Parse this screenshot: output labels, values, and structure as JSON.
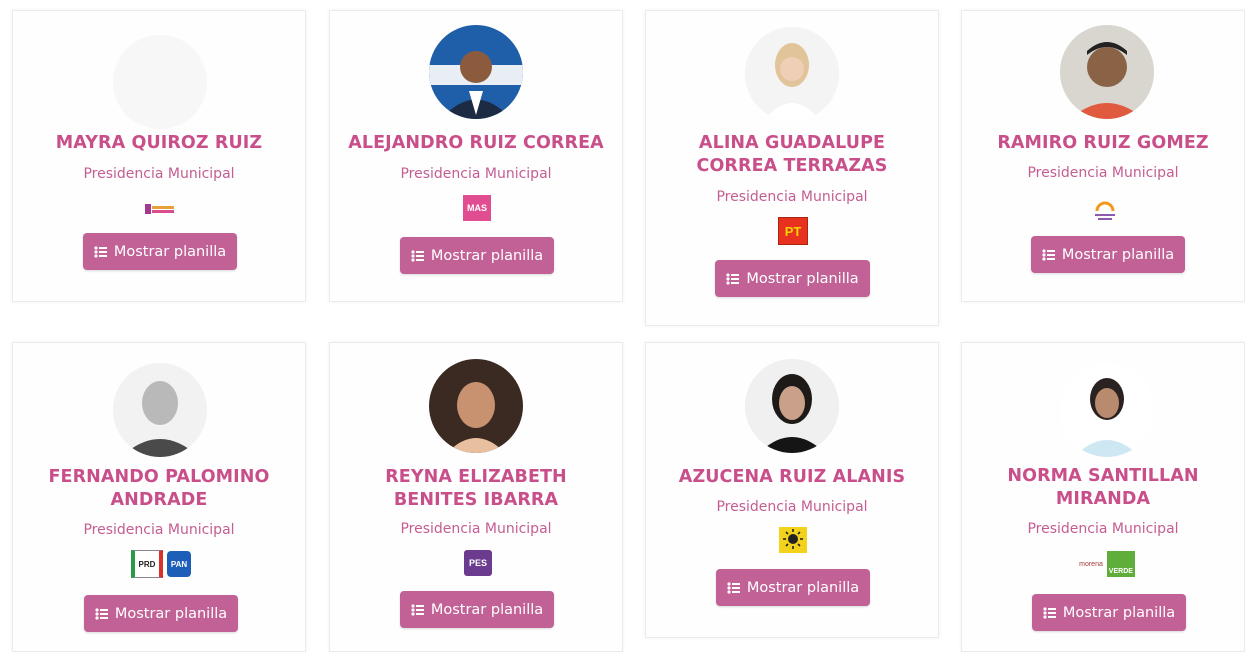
{
  "cards": [
    {
      "name": "MAYRA QUIROZ RUIZ",
      "role": "Presidencia Municipal",
      "party_logo": "Hope party logo",
      "button": "Mostrar planilla"
    },
    {
      "name": "ALEJANDRO RUIZ CORREA",
      "role": "Presidencia Municipal",
      "party_logo": "MAS",
      "button": "Mostrar planilla"
    },
    {
      "name": "ALINA GUADALUPE CORREA TERRAZAS",
      "role": "Presidencia Municipal",
      "party_logo": "PT",
      "button": "Mostrar planilla"
    },
    {
      "name": "RAMIRO RUIZ GOMEZ",
      "role": "Presidencia Municipal",
      "party_logo": "Movimiento Ciudadano",
      "button": "Mostrar planilla"
    },
    {
      "name": "FERNANDO PALOMINO ANDRADE",
      "role": "Presidencia Municipal",
      "party_logo": "PRD / PAN",
      "button": "Mostrar planilla"
    },
    {
      "name": "REYNA ELIZABETH BENITES IBARRA",
      "role": "Presidencia Municipal",
      "party_logo": "PES",
      "button": "Mostrar planilla"
    },
    {
      "name": "AZUCENA RUIZ ALANIS",
      "role": "Presidencia Municipal",
      "party_logo": "PRD sun",
      "button": "Mostrar planilla"
    },
    {
      "name": "NORMA SANTILLAN MIRANDA",
      "role": "Presidencia Municipal",
      "party_logo": "morena / VERDE",
      "button": "Mostrar planilla"
    }
  ],
  "logo_text": {
    "mas": "MAS",
    "pt": "PT",
    "prd": "PRD",
    "pan": "PAN",
    "pes": "PES",
    "morena": "morena",
    "verde": "VERDE"
  },
  "colors": {
    "accent": "#c94f8b",
    "button": "#c26196",
    "card_border": "#ecebec"
  }
}
